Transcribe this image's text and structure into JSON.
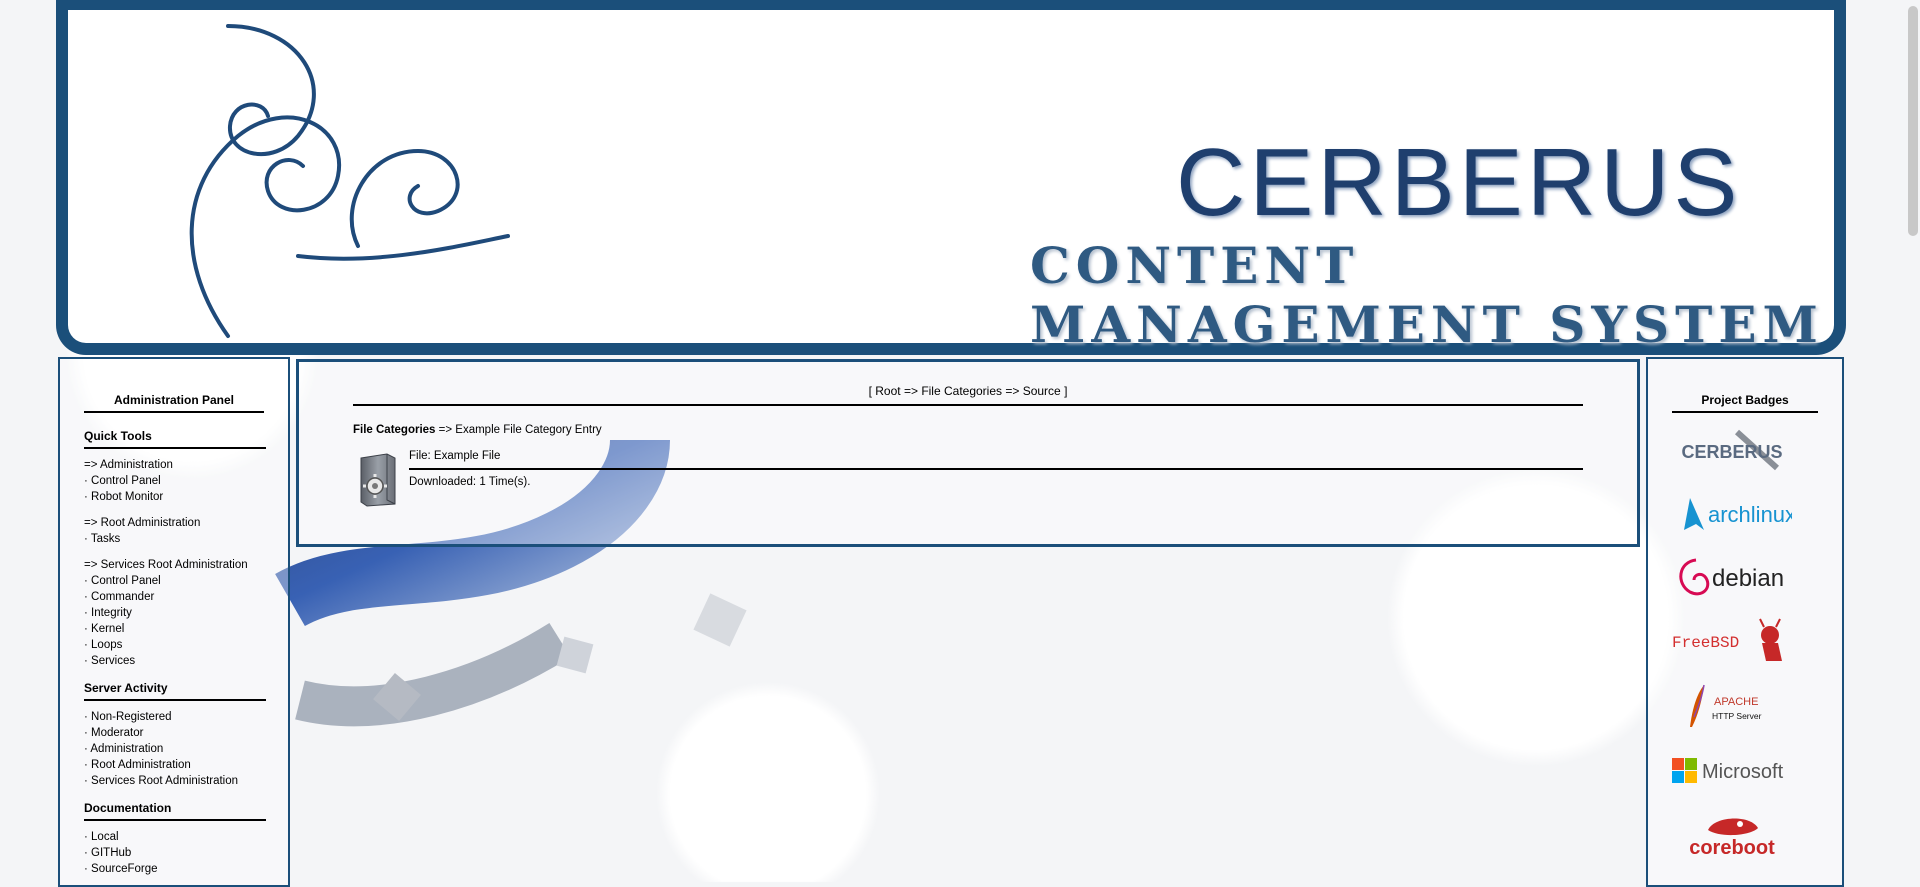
{
  "banner": {
    "title": "CERBERUS",
    "subtitle": "CONTENT MANAGEMENT SYSTEM"
  },
  "left_panel": {
    "title": "Administration Panel",
    "quick_tools": {
      "header": "Quick Tools",
      "groups": [
        {
          "label": "=> Administration",
          "items": [
            "· Control Panel",
            "· Robot Monitor"
          ]
        },
        {
          "label": "=> Root Administration",
          "items": [
            "· Tasks"
          ]
        },
        {
          "label": "=> Services Root Administration",
          "items": [
            "· Control Panel",
            "· Commander",
            "· Integrity",
            "· Kernel",
            "· Loops",
            "· Services"
          ]
        }
      ]
    },
    "server_activity": {
      "header": "Server Activity",
      "items": [
        "· Non-Registered",
        "· Moderator",
        "· Administration",
        "· Root Administration",
        "· Services Root Administration"
      ]
    },
    "documentation": {
      "header": "Documentation",
      "items": [
        "· Local",
        "· GITHub",
        "· SourceForge"
      ]
    }
  },
  "center": {
    "breadcrumb": {
      "open": "[ ",
      "root": "Root",
      "sep1": " => ",
      "file_categories": "File Categories",
      "sep2": " => ",
      "source": "Source",
      "close": " ]"
    },
    "category_line": {
      "label": "File Categories",
      "arrow": " => ",
      "entry": "Example File Category Entry"
    },
    "file": {
      "name": "File: Example File",
      "downloaded_label": "Downloaded:",
      "downloaded_value": " 1 Time(s)."
    }
  },
  "right_panel": {
    "title": "Project Badges",
    "badges": [
      {
        "name": "cerberus",
        "text": "CERBERUS",
        "color": "#5a6a80"
      },
      {
        "name": "archlinux",
        "text": "archlinux",
        "color": "#1793d1"
      },
      {
        "name": "debian",
        "text": "debian",
        "color": "#222222",
        "accent": "#d70a53"
      },
      {
        "name": "freebsd",
        "text": "FreeBSD",
        "color": "#d32f2f"
      },
      {
        "name": "apache",
        "text": "APACHE",
        "sub": "HTTP Server",
        "color": "#c0392b"
      },
      {
        "name": "microsoft",
        "text": "Microsoft",
        "color": "#555555"
      },
      {
        "name": "coreboot",
        "text": "coreboot",
        "color": "#c62828"
      }
    ]
  },
  "colors": {
    "frame": "#1b4f7a",
    "title": "#1f3f6e"
  }
}
